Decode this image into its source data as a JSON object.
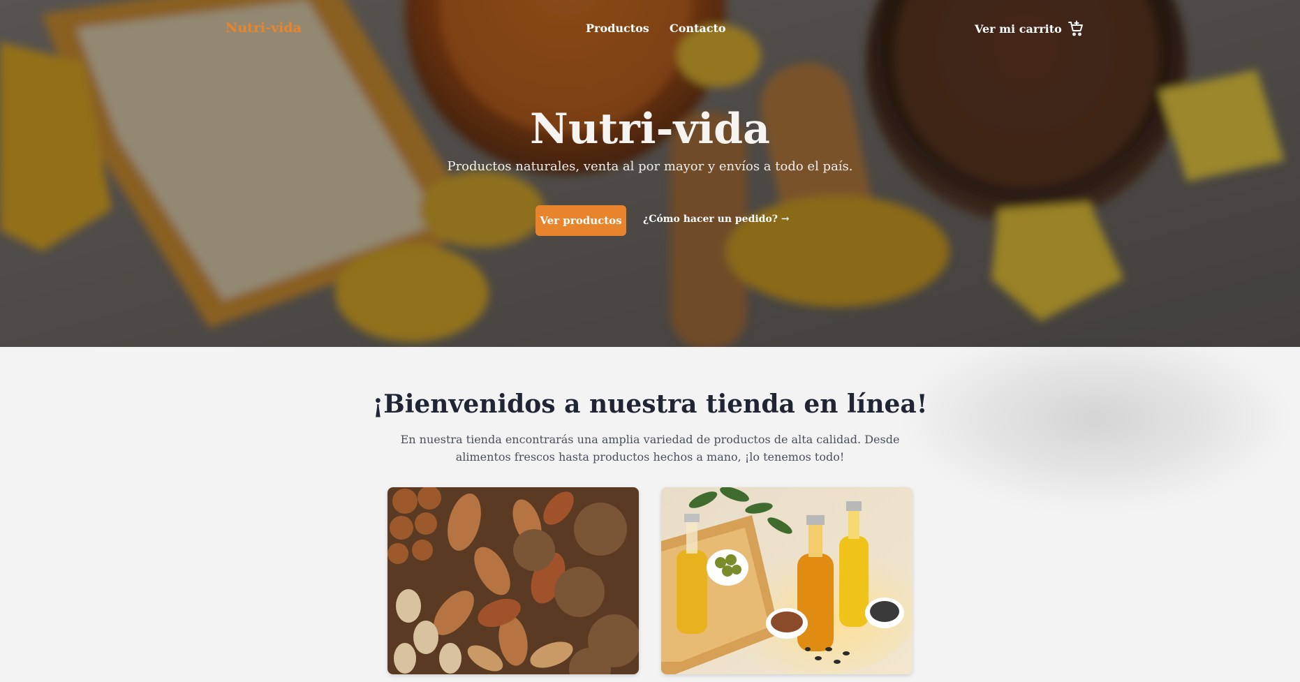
{
  "nav": {
    "brand": "Nutri-vida",
    "links": [
      {
        "label": "Productos"
      },
      {
        "label": "Contacto"
      }
    ],
    "cart_label": "Ver mi carrito",
    "cart_icon": "cart-icon"
  },
  "hero": {
    "title": "Nutri-vida",
    "subtitle": "Productos naturales, venta al por mayor y envíos a todo el país.",
    "primary_button": "Ver productos",
    "secondary_link": "¿Cómo hacer un pedido? →"
  },
  "welcome": {
    "title": "¡Bienvenidos a nuestra tienda en línea!",
    "text": "En nuestra tienda encontrarás una amplia variedad de productos de alta calidad. Desde alimentos frescos hasta productos hechos a mano, ¡lo tenemos todo!"
  },
  "colors": {
    "accent": "#e8842c",
    "heading": "#1f2533",
    "body_text": "#4a4f5c",
    "page_bg": "#f3f3f3"
  }
}
